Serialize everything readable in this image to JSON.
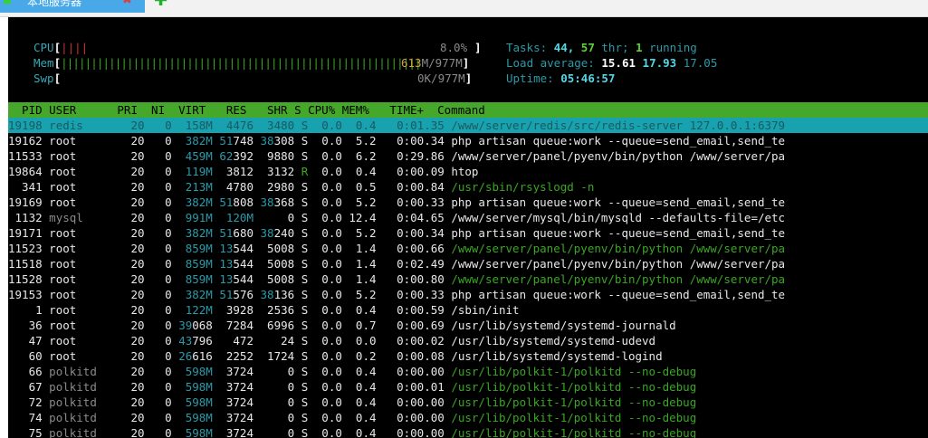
{
  "tab": {
    "title": "本地服务器",
    "close_icon": "✖",
    "add_icon": "✚"
  },
  "meters": {
    "cpu_label": "CPU",
    "cpu_bar": "||||",
    "cpu_value": "8.0%",
    "mem_label": "Mem",
    "mem_bar": "||||||||||||||||||||||||||||||||||||||||||||||||||||||||||||",
    "mem_value_used": "613",
    "mem_value_rest": "M/977M",
    "swp_label": "Swp",
    "swp_value": "0K/977M"
  },
  "stats": {
    "tasks_label": "Tasks:",
    "tasks_count": "44,",
    "threads_count": "57",
    "threads_label": "thr;",
    "running_count": "1",
    "running_label": "running",
    "load_label": "Load average:",
    "load1": "15.61",
    "load5": "17.93",
    "load15": "17.05",
    "uptime_label": "Uptime:",
    "uptime_value": "05:46:57"
  },
  "header_line": "  PID USER      PRI  NI  VIRT   RES   SHR S CPU% MEM%   TIME+  Command",
  "processes": [
    {
      "pid": "19198",
      "user": "redis",
      "pri": "20",
      "ni": "0",
      "virt": "158M",
      "res": "4476",
      "shr": "3480",
      "s": "S",
      "cpu": "0.0",
      "mem": "0.4",
      "time": "0:01.35",
      "cmd": "/www/server/redis/src/redis-server 127.0.0.1:6379",
      "selected": true
    },
    {
      "pid": "19162",
      "user": "root",
      "pri": "20",
      "ni": "0",
      "virt": "382M",
      "res": "51748",
      "shr": "38308",
      "s": "S",
      "cpu": "0.0",
      "mem": "5.2",
      "time": "0:00.34",
      "cmd": "php artisan queue:work --queue=send_email,send_te"
    },
    {
      "pid": "11533",
      "user": "root",
      "pri": "20",
      "ni": "0",
      "virt": "459M",
      "res": "62392",
      "shr": "9880",
      "s": "S",
      "cpu": "0.0",
      "mem": "6.2",
      "time": "0:29.86",
      "cmd": "/www/server/panel/pyenv/bin/python /www/server/pa"
    },
    {
      "pid": "19864",
      "user": "root",
      "pri": "20",
      "ni": "0",
      "virt": "119M",
      "res": "3812",
      "shr": "3132",
      "s": "R",
      "cpu": "0.0",
      "mem": "0.4",
      "time": "0:00.09",
      "cmd": "htop"
    },
    {
      "pid": "341",
      "user": "root",
      "pri": "20",
      "ni": "0",
      "virt": "213M",
      "res": "4780",
      "shr": "2980",
      "s": "S",
      "cpu": "0.0",
      "mem": "0.5",
      "time": "0:00.84",
      "cmd": "/usr/sbin/rsyslogd -n",
      "green": true
    },
    {
      "pid": "19169",
      "user": "root",
      "pri": "20",
      "ni": "0",
      "virt": "382M",
      "res": "51808",
      "shr": "38368",
      "s": "S",
      "cpu": "0.0",
      "mem": "5.2",
      "time": "0:00.33",
      "cmd": "php artisan queue:work --queue=send_email,send_te"
    },
    {
      "pid": "1132",
      "user": "mysql",
      "pri": "20",
      "ni": "0",
      "virt": "991M",
      "res": "120M",
      "shr": "0",
      "s": "S",
      "cpu": "0.0",
      "mem": "12.4",
      "time": "0:04.65",
      "cmd": "/www/server/mysql/bin/mysqld --defaults-file=/etc"
    },
    {
      "pid": "19171",
      "user": "root",
      "pri": "20",
      "ni": "0",
      "virt": "382M",
      "res": "51680",
      "shr": "38240",
      "s": "S",
      "cpu": "0.0",
      "mem": "5.2",
      "time": "0:00.34",
      "cmd": "php artisan queue:work --queue=send_email,send_te"
    },
    {
      "pid": "11523",
      "user": "root",
      "pri": "20",
      "ni": "0",
      "virt": "859M",
      "res": "13544",
      "shr": "5008",
      "s": "S",
      "cpu": "0.0",
      "mem": "1.4",
      "time": "0:00.66",
      "cmd": "/www/server/panel/pyenv/bin/python /www/server/pa",
      "green": true
    },
    {
      "pid": "11518",
      "user": "root",
      "pri": "20",
      "ni": "0",
      "virt": "859M",
      "res": "13544",
      "shr": "5008",
      "s": "S",
      "cpu": "0.0",
      "mem": "1.4",
      "time": "0:02.49",
      "cmd": "/www/server/panel/pyenv/bin/python /www/server/pa"
    },
    {
      "pid": "11528",
      "user": "root",
      "pri": "20",
      "ni": "0",
      "virt": "859M",
      "res": "13544",
      "shr": "5008",
      "s": "S",
      "cpu": "0.0",
      "mem": "1.4",
      "time": "0:00.80",
      "cmd": "/www/server/panel/pyenv/bin/python /www/server/pa",
      "green": true
    },
    {
      "pid": "19153",
      "user": "root",
      "pri": "20",
      "ni": "0",
      "virt": "382M",
      "res": "51576",
      "shr": "38136",
      "s": "S",
      "cpu": "0.0",
      "mem": "5.2",
      "time": "0:00.33",
      "cmd": "php artisan queue:work --queue=send_email,send_te"
    },
    {
      "pid": "1",
      "user": "root",
      "pri": "20",
      "ni": "0",
      "virt": "122M",
      "res": "3928",
      "shr": "2536",
      "s": "S",
      "cpu": "0.0",
      "mem": "0.4",
      "time": "0:00.59",
      "cmd": "/sbin/init"
    },
    {
      "pid": "36",
      "user": "root",
      "pri": "20",
      "ni": "0",
      "virt": "39068",
      "res": "7284",
      "shr": "6996",
      "s": "S",
      "cpu": "0.0",
      "mem": "0.7",
      "time": "0:00.69",
      "cmd": "/usr/lib/systemd/systemd-journald"
    },
    {
      "pid": "47",
      "user": "root",
      "pri": "20",
      "ni": "0",
      "virt": "43796",
      "res": "472",
      "shr": "24",
      "s": "S",
      "cpu": "0.0",
      "mem": "0.0",
      "time": "0:00.02",
      "cmd": "/usr/lib/systemd/systemd-udevd"
    },
    {
      "pid": "60",
      "user": "root",
      "pri": "20",
      "ni": "0",
      "virt": "26616",
      "res": "2252",
      "shr": "1724",
      "s": "S",
      "cpu": "0.0",
      "mem": "0.2",
      "time": "0:00.08",
      "cmd": "/usr/lib/systemd/systemd-logind"
    },
    {
      "pid": "66",
      "user": "polkitd",
      "pri": "20",
      "ni": "0",
      "virt": "598M",
      "res": "3724",
      "shr": "0",
      "s": "S",
      "cpu": "0.0",
      "mem": "0.4",
      "time": "0:00.00",
      "cmd": "/usr/lib/polkit-1/polkitd --no-debug",
      "green": true
    },
    {
      "pid": "67",
      "user": "polkitd",
      "pri": "20",
      "ni": "0",
      "virt": "598M",
      "res": "3724",
      "shr": "0",
      "s": "S",
      "cpu": "0.0",
      "mem": "0.4",
      "time": "0:00.01",
      "cmd": "/usr/lib/polkit-1/polkitd --no-debug",
      "green": true
    },
    {
      "pid": "72",
      "user": "polkitd",
      "pri": "20",
      "ni": "0",
      "virt": "598M",
      "res": "3724",
      "shr": "0",
      "s": "S",
      "cpu": "0.0",
      "mem": "0.4",
      "time": "0:00.00",
      "cmd": "/usr/lib/polkit-1/polkitd --no-debug",
      "green": true
    },
    {
      "pid": "74",
      "user": "polkitd",
      "pri": "20",
      "ni": "0",
      "virt": "598M",
      "res": "3724",
      "shr": "0",
      "s": "S",
      "cpu": "0.0",
      "mem": "0.4",
      "time": "0:00.00",
      "cmd": "/usr/lib/polkit-1/polkitd --no-debug",
      "green": true
    },
    {
      "pid": "75",
      "user": "polkitd",
      "pri": "20",
      "ni": "0",
      "virt": "598M",
      "res": "3724",
      "shr": "0",
      "s": "S",
      "cpu": "0.0",
      "mem": "0.4",
      "time": "0:00.00",
      "cmd": "/usr/lib/polkit-1/polkitd --no-debug",
      "green": true
    }
  ]
}
